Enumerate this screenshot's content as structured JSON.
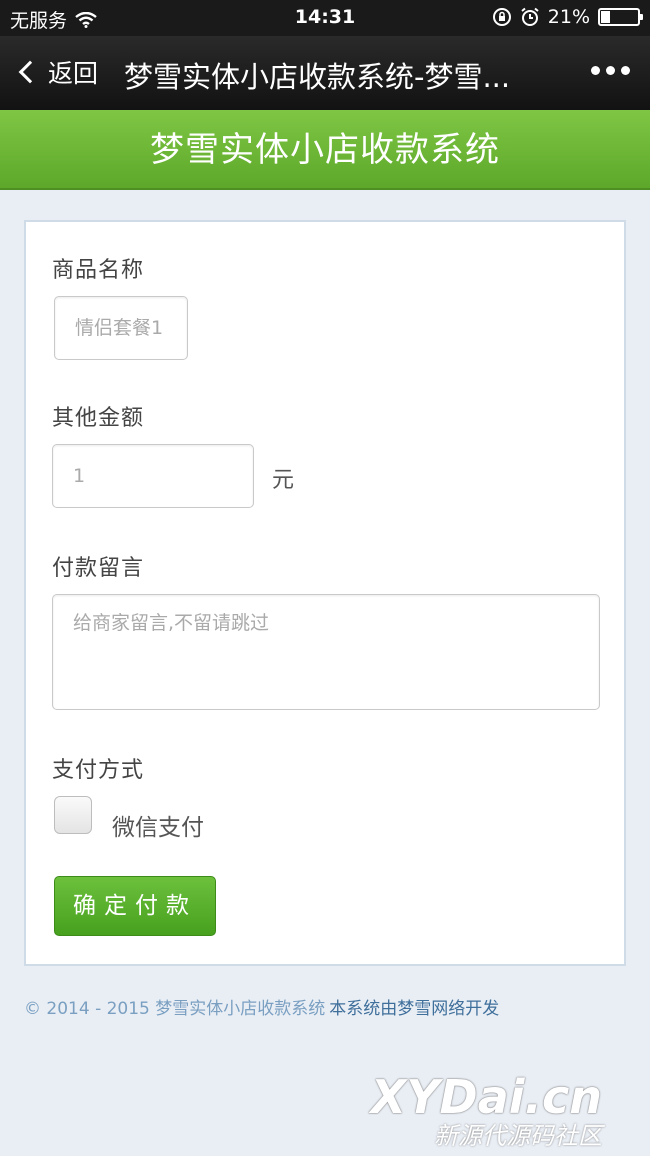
{
  "status_bar": {
    "carrier": "无服务",
    "time": "14:31",
    "battery": "21%",
    "battery_level": 0.21
  },
  "nav": {
    "back_label": "返回",
    "title": "梦雪实体小店收款系统-梦雪..."
  },
  "header": {
    "title": "梦雪实体小店收款系统"
  },
  "form": {
    "product_label": "商品名称",
    "product_placeholder": "情侣套餐1",
    "amount_label": "其他金额",
    "amount_placeholder": "1",
    "amount_unit": "元",
    "message_label": "付款留言",
    "message_placeholder": "给商家留言,不留请跳过",
    "payment_label": "支付方式",
    "payment_option": "微信支付",
    "submit_label": "确定付款"
  },
  "footer": {
    "copyright": "© 2014 - 2015 梦雪实体小店收款系统",
    "developer": "本系统由梦雪网络开发"
  },
  "watermark": {
    "main": "XYDai.cn",
    "sub": "新源代源码社区"
  },
  "colors": {
    "header_green": "#6bb836",
    "button_green": "#52a825",
    "background": "#e9eef5"
  },
  "icons": [
    "wifi-icon",
    "rotation-lock-icon",
    "alarm-icon",
    "battery-icon",
    "back-chevron-icon",
    "more-icon"
  ]
}
